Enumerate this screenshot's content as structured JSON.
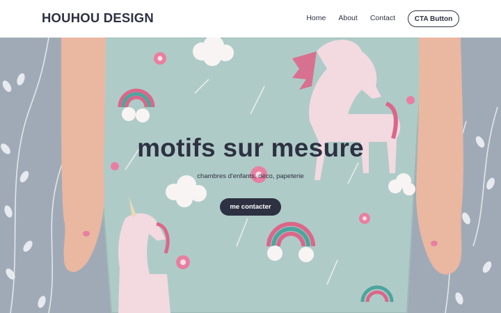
{
  "brand": {
    "name": "HOUHOU DESIGN"
  },
  "nav": {
    "items": [
      {
        "label": "Home"
      },
      {
        "label": "About"
      },
      {
        "label": "Contact"
      }
    ],
    "cta_label": "CTA Button"
  },
  "hero": {
    "title": "motifs sur mesure",
    "subtitle": "chambres d'enfants, déco, papeterie",
    "button_label": "me contacter",
    "image_description_icons": [
      "unicorn-motif",
      "cloud-motif",
      "rainbow-motif",
      "flower-motif"
    ]
  },
  "colors": {
    "primary": "#2d3142",
    "header_bg": "#ffffff",
    "fabric": "#a9c7c3",
    "wall": "#98a3b1",
    "skin": "#e9b19a",
    "rainbow_pink": "#d95a7f",
    "rainbow_teal": "#3e9e95"
  }
}
